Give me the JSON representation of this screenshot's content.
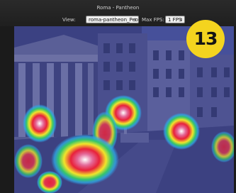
{
  "window": {
    "title": "Roma - Pantheon"
  },
  "toolbar": {
    "view_label": "View:",
    "view_value": "roma-pantheon_People",
    "fps_label": "Max FPS:",
    "fps_value": "1 FPS"
  },
  "badge": {
    "number": "13"
  },
  "heatmap": {
    "blobs": [
      {
        "name": "heat-blob-left",
        "intensity": 0.8
      },
      {
        "name": "heat-blob-center-top",
        "intensity": 0.7
      },
      {
        "name": "heat-blob-main",
        "intensity": 1.0
      },
      {
        "name": "heat-blob-right",
        "intensity": 0.7
      },
      {
        "name": "heat-blob-bottom-left",
        "intensity": 0.5
      }
    ]
  },
  "colors": {
    "overlay": "#3a3f8c",
    "heat_hot": "#ffffff",
    "heat_mid": "#e8213a",
    "heat_warm": "#f1e52a",
    "heat_cool": "#35c56b",
    "heat_edge": "#2fa6e6",
    "badge": "#f4d41f"
  }
}
